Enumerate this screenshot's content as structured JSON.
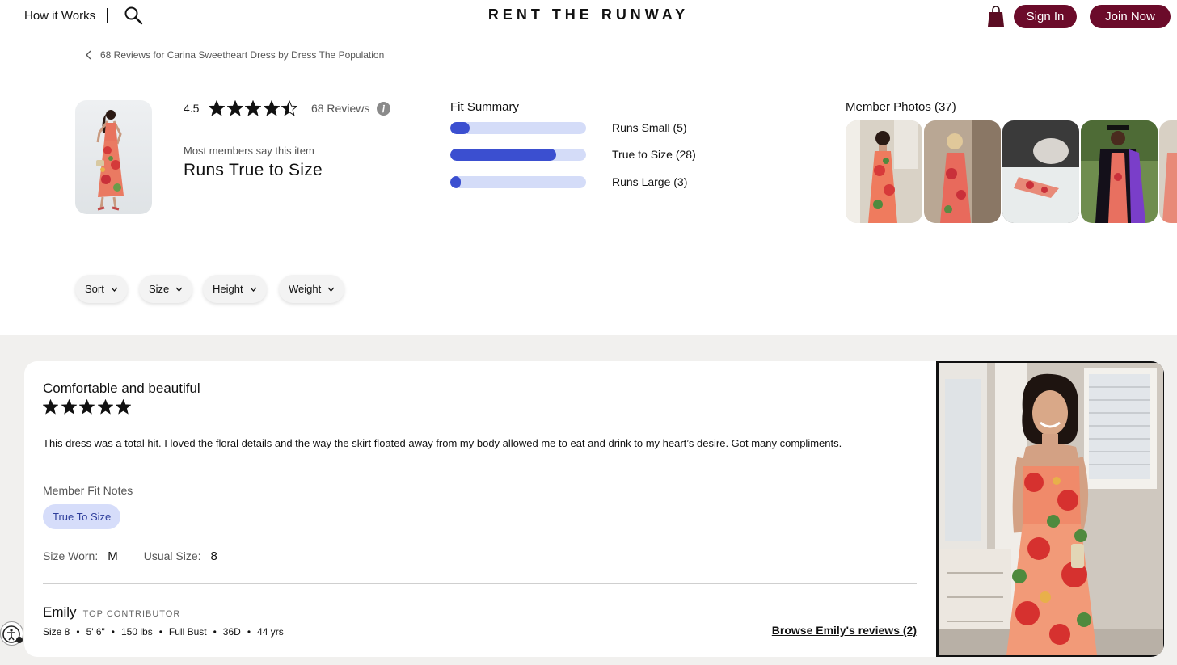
{
  "header": {
    "how_it_works": "How it Works",
    "logo": "RENT THE RUNWAY",
    "sign_in": "Sign In",
    "join_now": "Join Now",
    "accent_color": "#6b0b2a"
  },
  "breadcrumb": {
    "text": "68 Reviews for Carina Sweetheart Dress by Dress The Population"
  },
  "summary": {
    "rating": "4.5",
    "rating_value": 4.5,
    "review_count": "68 Reviews",
    "most_members": "Most members say this item",
    "verdict": "Runs True to Size"
  },
  "fit_summary": {
    "title": "Fit Summary",
    "bar_color": "#3b4fd0",
    "track_color": "#d4dcf8",
    "items": [
      {
        "label": "Runs Small (5)",
        "count": 5,
        "fill": 0.14
      },
      {
        "label": "True to Size (28)",
        "count": 28,
        "fill": 0.78
      },
      {
        "label": "Runs Large (3)",
        "count": 3,
        "fill": 0.08
      }
    ]
  },
  "member_photos": {
    "title": "Member Photos (37)"
  },
  "filters": [
    "Sort",
    "Size",
    "Height",
    "Weight"
  ],
  "review": {
    "title": "Comfortable and beautiful",
    "stars": 5,
    "text": "This dress was a total hit. I loved the floral details and the way the skirt floated away from my body allowed me to eat and drink to my heart’s desire. Got many compliments.",
    "fit_notes_label": "Member Fit Notes",
    "fit_note": "True To Size",
    "size_worn_label": "Size Worn:",
    "size_worn": "M",
    "usual_size_label": "Usual Size:",
    "usual_size": "8",
    "reviewer": {
      "name": "Emily",
      "badge": "TOP CONTRIBUTOR",
      "stats": [
        "Size 8",
        "5' 6\"",
        "150 lbs",
        "Full Bust",
        "36D",
        "44 yrs"
      ]
    },
    "browse_link": "Browse Emily's reviews (2)"
  }
}
